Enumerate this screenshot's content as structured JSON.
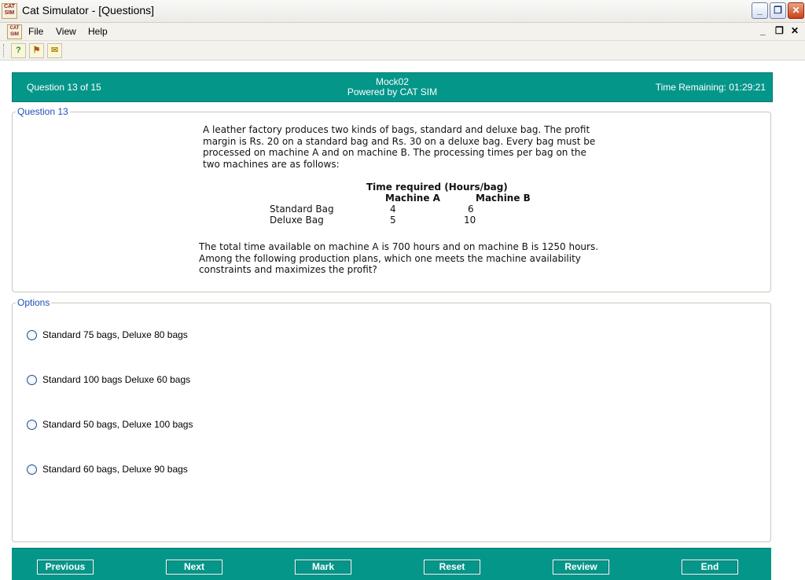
{
  "window": {
    "app_icon_text": "CAT SIM",
    "title": "Cat Simulator - [Questions]",
    "min_glyph": "_",
    "restore_glyph": "❐",
    "close_glyph": "✕"
  },
  "menu": {
    "items": [
      "File",
      "View",
      "Help"
    ],
    "mdi_min": "_",
    "mdi_restore": "❐",
    "mdi_close": "✕"
  },
  "toolbar": {
    "icons": [
      "help-icon",
      "person-icon",
      "mail-icon"
    ],
    "glyphs": [
      "?",
      "⚑",
      "✉"
    ]
  },
  "header": {
    "question_counter": "Question 13 of 15",
    "mock_name": "Mock02",
    "powered_by": "Powered by CAT SIM",
    "time_remaining": "Time Remaining: 01:29:21"
  },
  "question": {
    "legend": "Question 13",
    "intro_lines": [
      "A leather factory produces two kinds of bags, standard and deluxe bag. The profit",
      "margin is Rs. 20 on a standard bag and Rs. 30 on a  deluxe bag. Every bag must be",
      "processed on machine A and on machine B. The processing times per bag on the",
      "two machines are as follows:"
    ],
    "table": {
      "caption": "Time required (Hours/bag)",
      "col_a": "Machine A",
      "col_b": "Machine B",
      "rows": [
        {
          "label": "Standard Bag",
          "a": "4",
          "b": "6"
        },
        {
          "label": "Deluxe Bag",
          "a": "5",
          "b": "10"
        }
      ]
    },
    "outro_lines": [
      "The total time available on machine A is 700 hours and on machine B is 1250 hours.",
      "Among the following production plans, which one meets the machine availability",
      "constraints and maximizes the profit?"
    ]
  },
  "options": {
    "legend": "Options",
    "items": [
      "Standard 75 bags, Deluxe 80 bags",
      "Standard 100 bags Deluxe 60 bags",
      "Standard 50 bags, Deluxe 100 bags",
      "Standard 60 bags, Deluxe 90 bags"
    ]
  },
  "footer": {
    "buttons": [
      "Previous",
      "Next",
      "Mark",
      "Reset",
      "Review",
      "End"
    ]
  },
  "colors": {
    "band": "#05968a",
    "legend": "#1d50b8"
  }
}
